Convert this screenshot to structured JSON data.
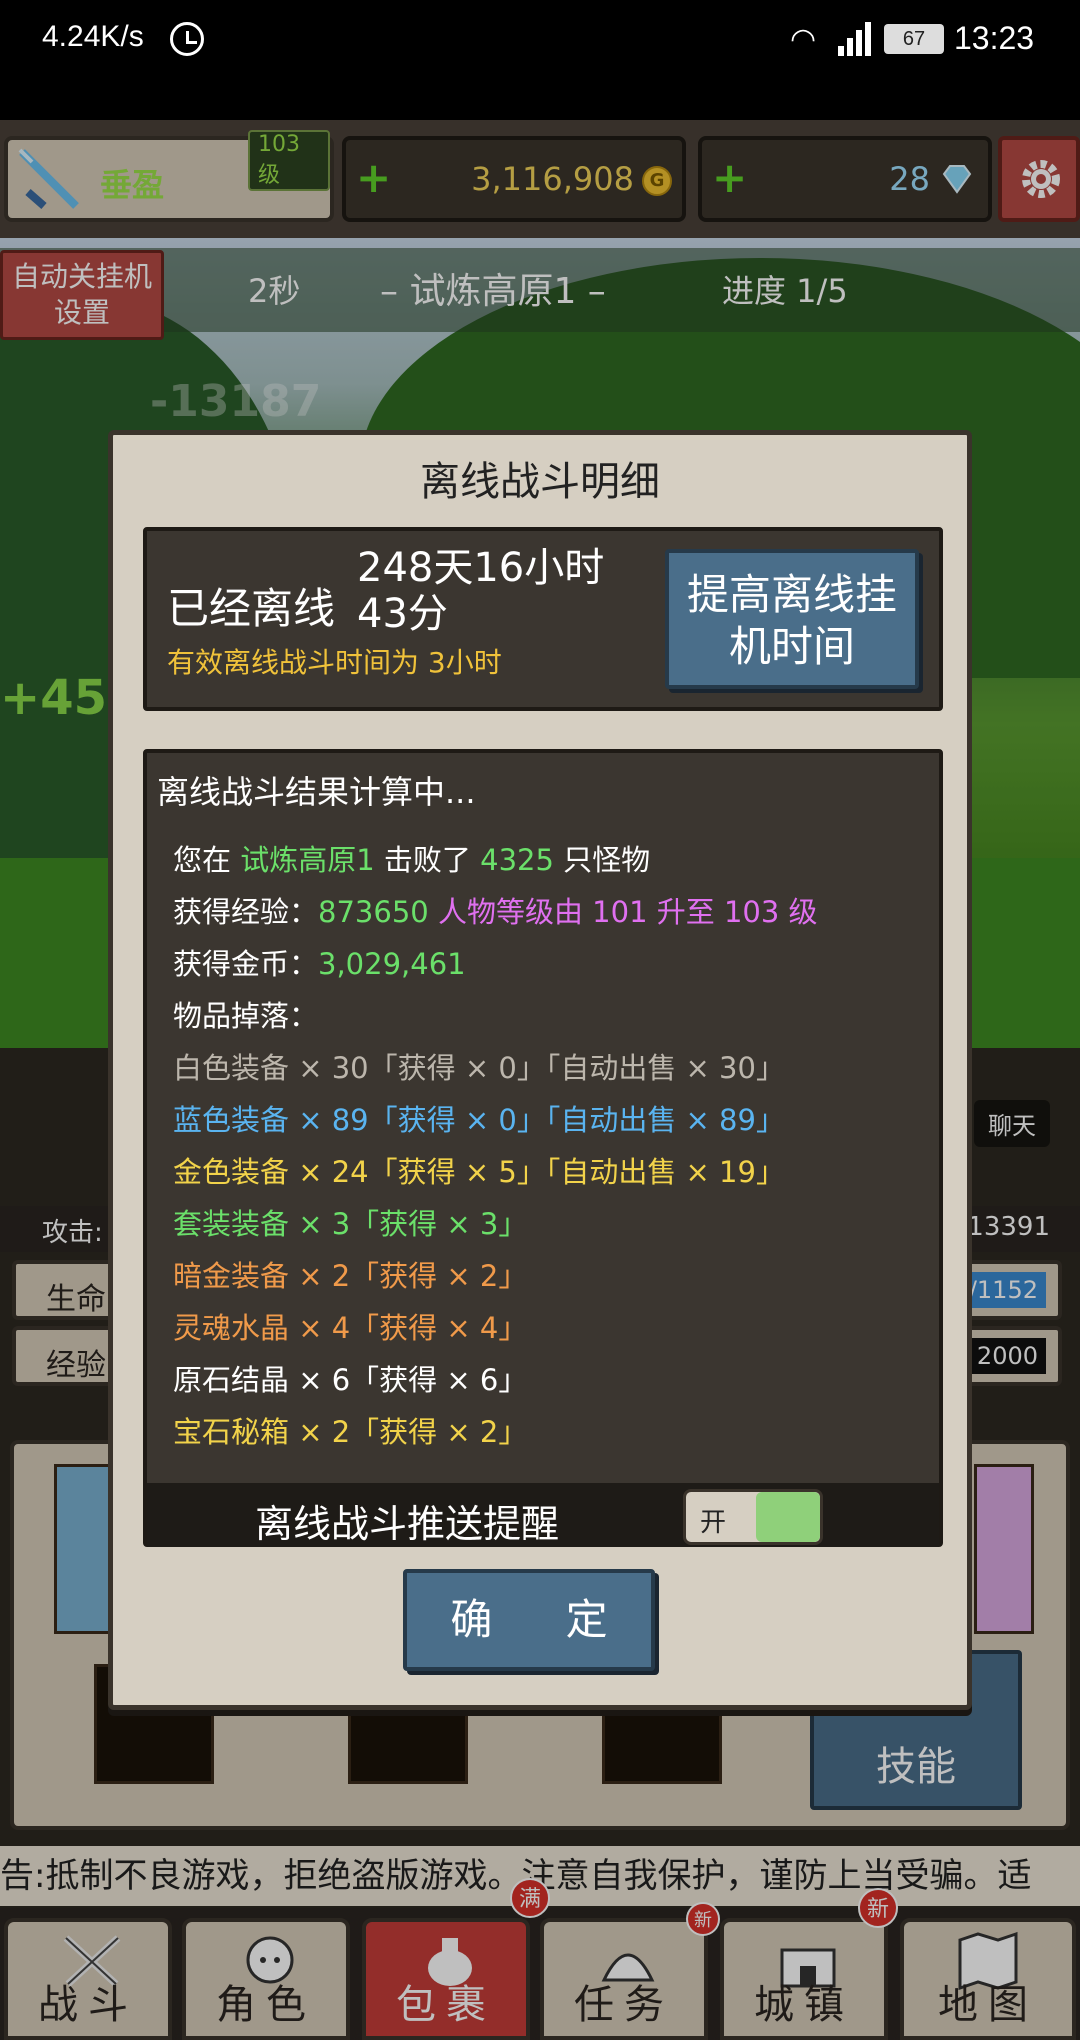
{
  "status_bar": {
    "net_speed": "4.24K/s",
    "battery": "67",
    "time": "13:23"
  },
  "player": {
    "name": "垂盈",
    "level_badge": "103 级",
    "gold": "3,116,908",
    "gems": "28"
  },
  "stage": {
    "auto_button": "自动关挂机设置",
    "timer": "2秒",
    "name": "– 试炼高原1 –",
    "progress": "进度 1/5"
  },
  "background": {
    "float_number": "-13187",
    "heal_number": "+45",
    "chat_label": "聊天",
    "attack_label": "攻击:",
    "attack_value": "13391",
    "hp_label": "生命",
    "hp_value": "/1152",
    "exp_label": "经验",
    "exp_value": "2000",
    "learn_skill_label": "技能"
  },
  "ticker_text": "告:抵制不良游戏，拒绝盗版游戏。注意自我保护，谨防上当受骗。适",
  "modal": {
    "title": "离线战斗明细",
    "offline_label": "已经离线",
    "offline_duration": "248天16小时43分",
    "effective_time": "有效离线战斗时间为 3小时",
    "boost_button": "提高离线挂机时间",
    "result_header": "离线战斗结果计算中...",
    "summary": {
      "prefix": "您在",
      "stage": "试炼高原1",
      "mid": "击败了",
      "kills": "4325",
      "suffix": "只怪物"
    },
    "exp": {
      "label": "获得经验：",
      "value": "873650",
      "level_text": "人物等级由 101 升至 103 级"
    },
    "gold": {
      "label": "获得金币：",
      "value": "3,029,461"
    },
    "drops_label": "物品掉落：",
    "drops": [
      {
        "text": "白色装备 × 30「获得 × 0」「自动出售 × 30」",
        "color": "#bcb6ac"
      },
      {
        "text": "蓝色装备 × 89「获得 × 0」「自动出售 × 89」",
        "color": "#5ab4f0"
      },
      {
        "text": "金色装备 × 24「获得 × 5」「自动出售 × 19」",
        "color": "#f2d34a"
      },
      {
        "text": "套装装备 × 3「获得 × 3」",
        "color": "#6be06a"
      },
      {
        "text": "暗金装备 × 2「获得 × 2」",
        "color": "#f09a4a"
      },
      {
        "text": "灵魂水晶 × 4「获得 × 4」",
        "color": "#f09a4a"
      },
      {
        "text": "原石结晶 × 6「获得 × 6」",
        "color": "#ffffff"
      },
      {
        "text": "宝石秘箱 × 2「获得 × 2」",
        "color": "#f2d34a"
      }
    ],
    "push_label": "离线战斗推送提醒",
    "toggle_text": "开",
    "confirm_button": "确 定"
  },
  "nav": {
    "tabs": [
      {
        "label": "战斗",
        "icon": "crossed-swords-icon"
      },
      {
        "label": "角色",
        "icon": "character-icon"
      },
      {
        "label": "包裹",
        "icon": "bag-icon"
      },
      {
        "label": "任务",
        "icon": "quest-icon"
      },
      {
        "label": "城镇",
        "icon": "castle-icon"
      },
      {
        "label": "地图",
        "icon": "map-icon"
      }
    ],
    "badge_new": "新",
    "badge_full": "满"
  }
}
